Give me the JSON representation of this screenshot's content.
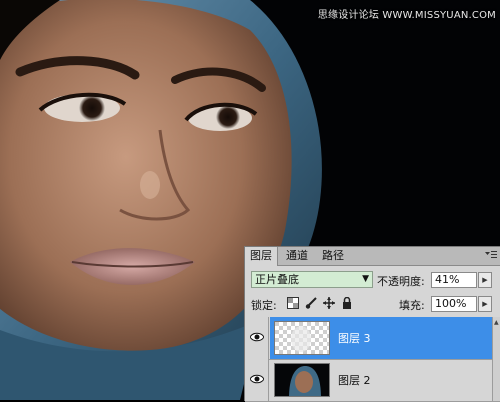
{
  "watermark": "思缘设计论坛 WWW.MISSYUAN.COM",
  "layers_panel": {
    "tabs": [
      "图层",
      "通道",
      "路径"
    ],
    "active_tab": "图层",
    "blend_mode": "正片叠底",
    "opacity_label": "不透明度:",
    "opacity_value": "41%",
    "lock_label": "锁定:",
    "fill_label": "填充:",
    "fill_value": "100%",
    "layers": [
      {
        "name": "图层 3",
        "selected": true,
        "visible": true
      },
      {
        "name": "图层 2",
        "selected": false,
        "visible": true
      }
    ]
  },
  "icons": {
    "eye": "eye-icon",
    "lock_transparent": "lock-transparent-icon",
    "lock_paint": "brush-icon",
    "lock_move": "move-icon",
    "lock_all": "lock-icon",
    "panel_menu": "panel-menu-icon"
  },
  "colors": {
    "selected_row": "#3d8ee8",
    "blend_field": "#d3ecd3",
    "panel_bg": "#d6d6d6",
    "hijab_blue": "#3f6a86"
  }
}
